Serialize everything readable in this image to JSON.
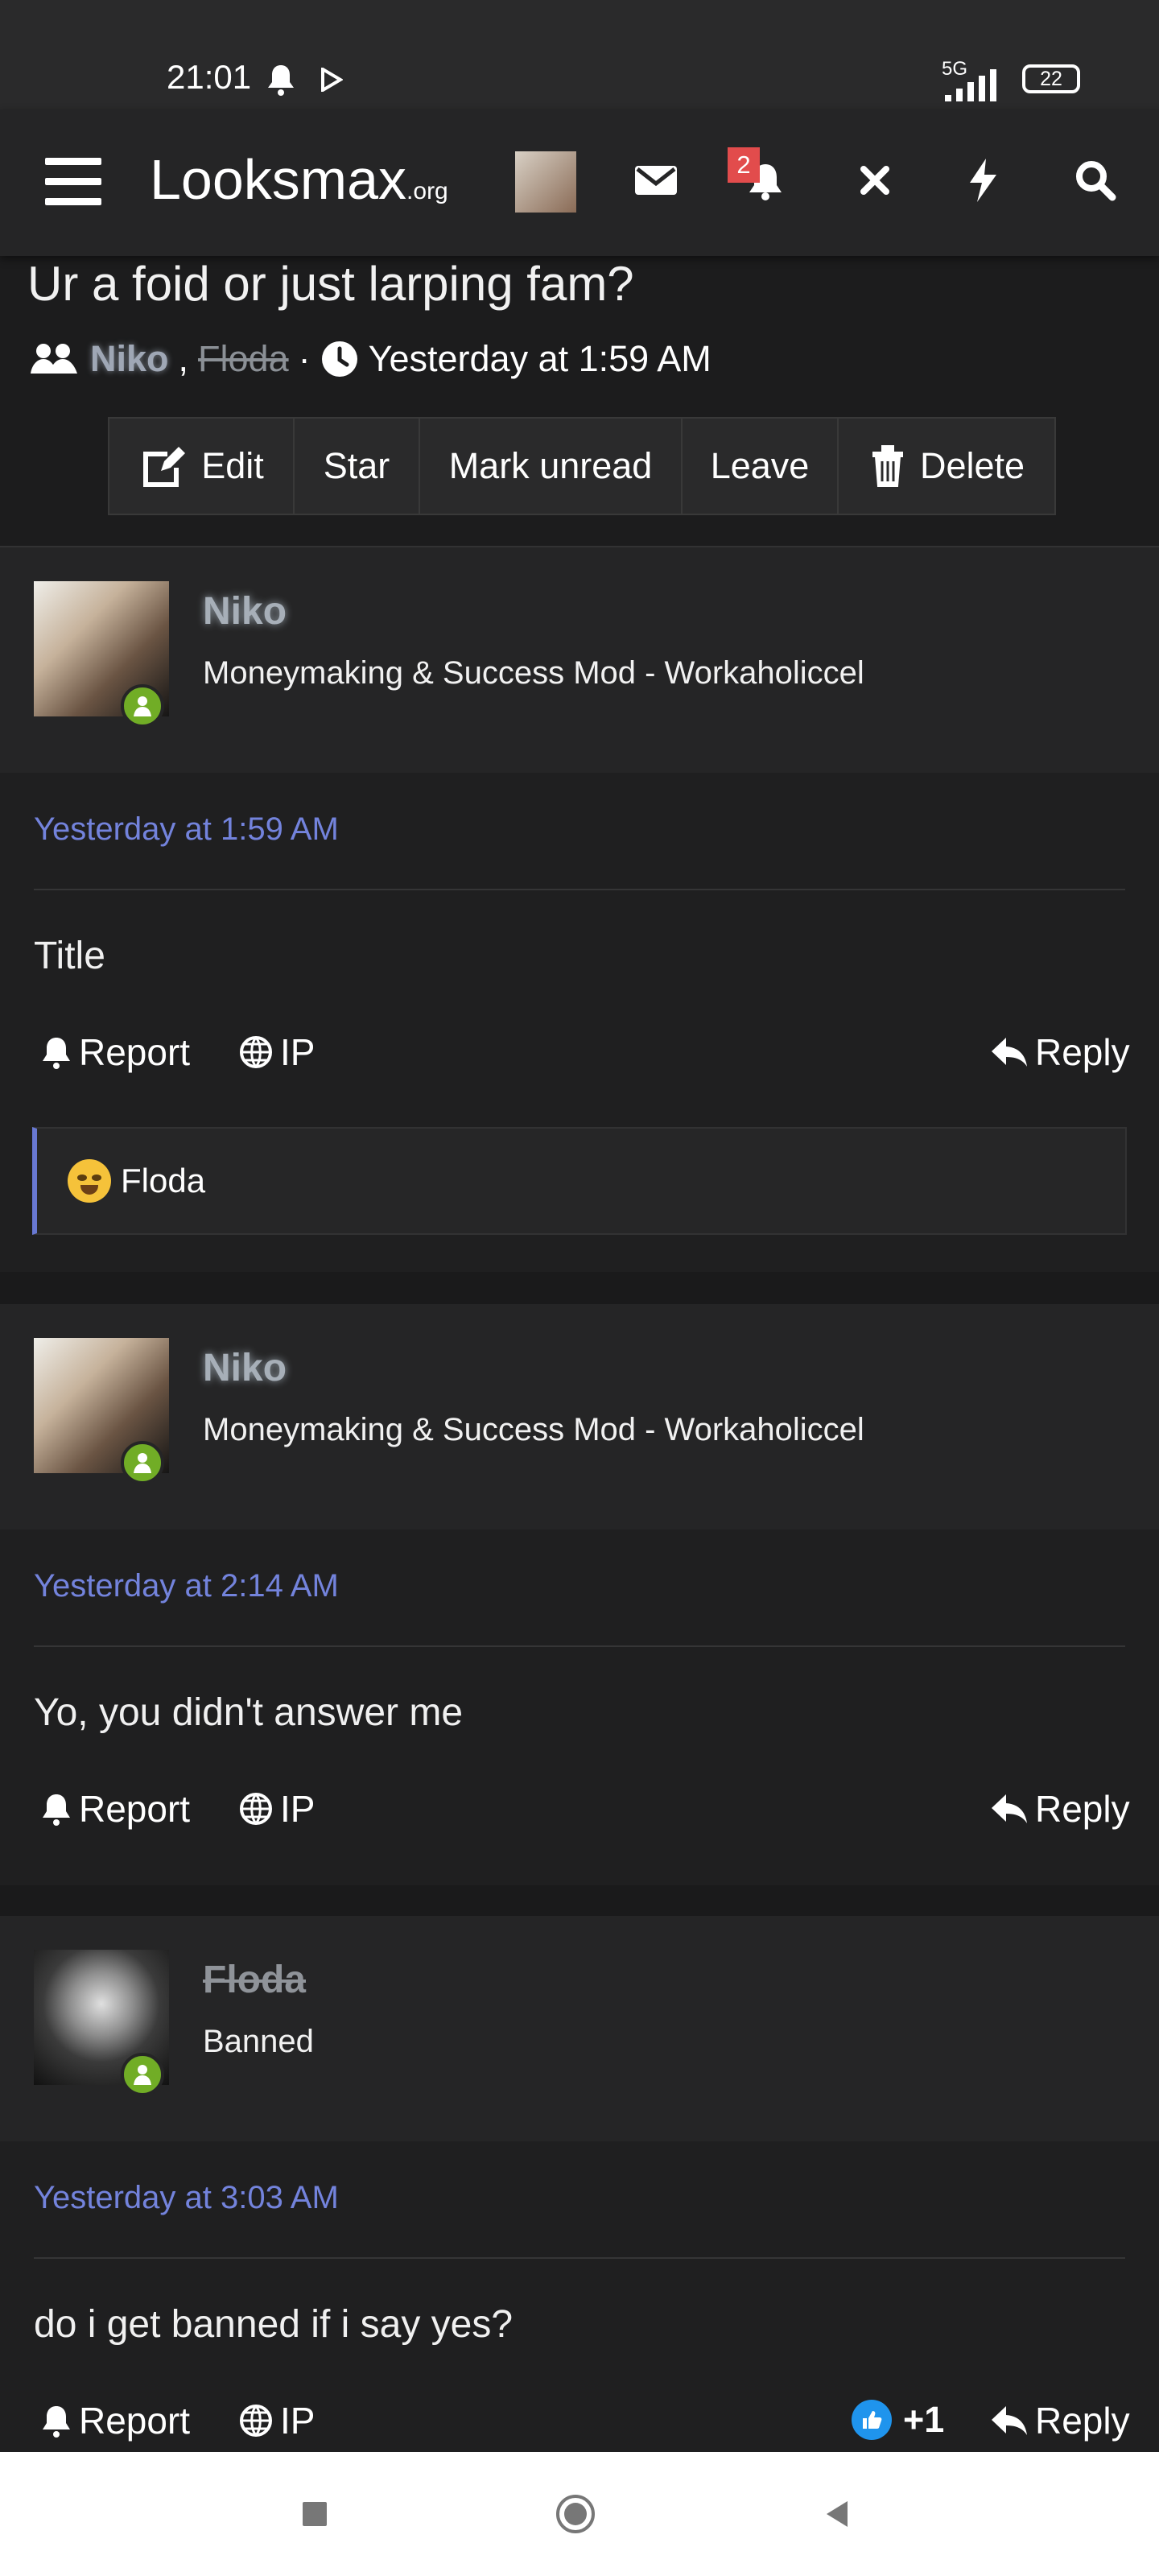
{
  "status_bar": {
    "time": "21:01",
    "network": "5G",
    "battery": "22"
  },
  "header": {
    "logo_main": "Looksmax",
    "logo_suffix": ".org",
    "notification_count": "2",
    "icons": [
      "menu-icon",
      "avatar",
      "mail-icon",
      "bell-icon",
      "close-icon",
      "bolt-icon",
      "search-icon"
    ]
  },
  "thread": {
    "title": "Ur a foid or just larping fam?",
    "participants": [
      "Niko",
      "Floda"
    ],
    "separator": ",",
    "meta_dot": "·",
    "date": "Yesterday at 1:59 AM",
    "actions": [
      "Edit",
      "Star",
      "Mark unread",
      "Leave",
      "Delete"
    ]
  },
  "posts": [
    {
      "user": "Niko",
      "role": "Moneymaking & Success Mod - Workaholiccel",
      "time": "Yesterday at 1:59 AM",
      "message": "Title",
      "quote": "Floda"
    },
    {
      "user": "Niko",
      "role": "Moneymaking & Success Mod - Workaholiccel",
      "time": "Yesterday at 2:14 AM",
      "message": "Yo, you didn't answer me"
    },
    {
      "user": "Floda",
      "role": "Banned",
      "time": "Yesterday at 3:03 AM",
      "message": "do i get banned if i say yes?",
      "likes": "+1"
    }
  ],
  "controls": {
    "report": "Report",
    "ip": "IP",
    "reply": "Reply"
  },
  "colors": {
    "background": "#1c1c1d",
    "header": "#252526",
    "link": "#7383dc",
    "online": "#71ad26",
    "quote_border": "#6878d2",
    "notification": "#e24c4c",
    "like": "#1f94ed"
  }
}
